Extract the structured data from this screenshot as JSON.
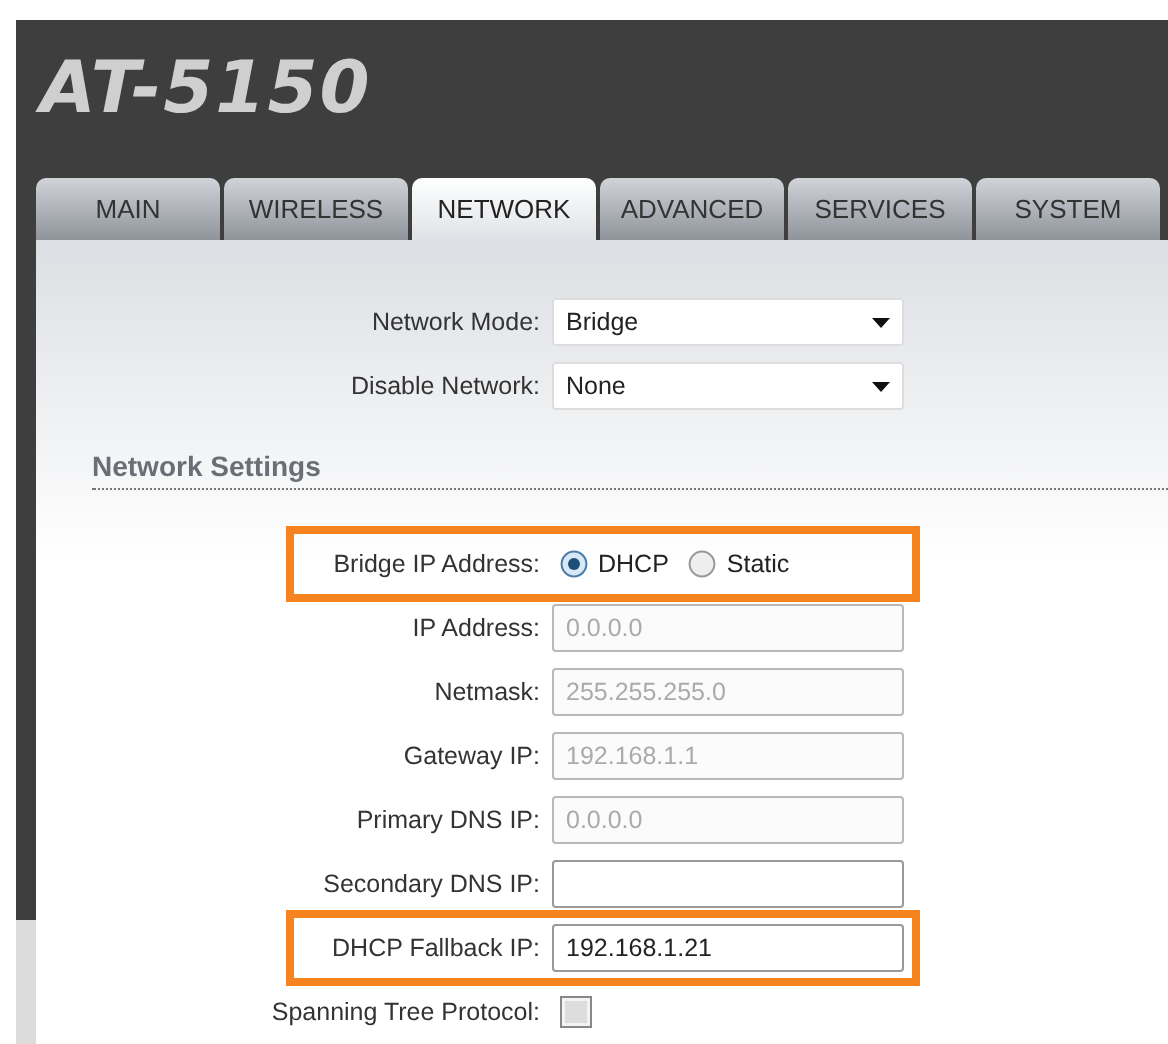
{
  "header": {
    "title": "AT-5150"
  },
  "tabs": [
    {
      "label": "MAIN",
      "selected": false
    },
    {
      "label": "WIRELESS",
      "selected": false
    },
    {
      "label": "NETWORK",
      "selected": true
    },
    {
      "label": "ADVANCED",
      "selected": false
    },
    {
      "label": "SERVICES",
      "selected": false
    },
    {
      "label": "SYSTEM",
      "selected": false
    }
  ],
  "top_fields": [
    {
      "kind": "select",
      "label": "Network Mode:",
      "value": "Bridge"
    },
    {
      "kind": "select",
      "label": "Disable Network:",
      "value": "None"
    }
  ],
  "network_settings": {
    "title": "Network Settings",
    "fields": [
      {
        "kind": "radio",
        "label": "Bridge IP Address:",
        "highlighted": true,
        "options": [
          {
            "label": "DHCP",
            "selected": true
          },
          {
            "label": "Static",
            "selected": false
          }
        ]
      },
      {
        "kind": "text",
        "label": "IP Address:",
        "value": "0.0.0.0",
        "disabled": true,
        "highlighted": false
      },
      {
        "kind": "text",
        "label": "Netmask:",
        "value": "255.255.255.0",
        "disabled": true,
        "highlighted": false
      },
      {
        "kind": "text",
        "label": "Gateway IP:",
        "value": "192.168.1.1",
        "disabled": true,
        "highlighted": false
      },
      {
        "kind": "text",
        "label": "Primary DNS IP:",
        "value": "0.0.0.0",
        "disabled": true,
        "highlighted": false
      },
      {
        "kind": "text",
        "label": "Secondary DNS IP:",
        "disabled": false,
        "highlighted": false
      },
      {
        "kind": "text",
        "label": "DHCP Fallback IP:",
        "value": "192.168.1.21",
        "disabled": false,
        "highlighted": true
      },
      {
        "kind": "checkbox",
        "label": "Spanning Tree Protocol:",
        "checked": false,
        "highlighted": false
      }
    ]
  }
}
